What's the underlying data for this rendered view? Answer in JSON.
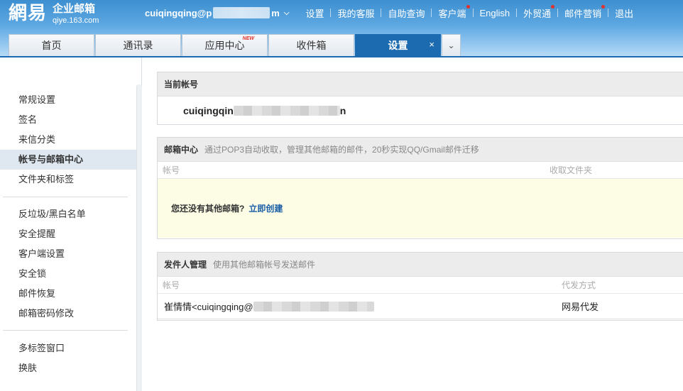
{
  "logo": {
    "main": "網易",
    "title": "企业邮箱",
    "domain": "qiye.163.com"
  },
  "account": {
    "visible_start": "cuiqingqing@p",
    "visible_end": "m"
  },
  "topnav": [
    {
      "label": "设置",
      "dot": false
    },
    {
      "label": "我的客服",
      "dot": false
    },
    {
      "label": "自助查询",
      "dot": false
    },
    {
      "label": "客户端",
      "dot": true
    },
    {
      "label": "English",
      "dot": false
    },
    {
      "label": "外贸通",
      "dot": true
    },
    {
      "label": "邮件营销",
      "dot": true
    },
    {
      "label": "退出",
      "dot": false
    }
  ],
  "tabs": [
    {
      "label": "首页"
    },
    {
      "label": "通讯录"
    },
    {
      "label": "应用中心",
      "badge": "NEW"
    },
    {
      "label": "收件箱"
    },
    {
      "label": "设置",
      "active": true,
      "close": "×"
    }
  ],
  "tab_more": "⌄",
  "sidebar": {
    "group1": [
      "常规设置",
      "签名",
      "来信分类",
      "帐号与邮箱中心",
      "文件夹和标签"
    ],
    "group2": [
      "反垃圾/黑白名单",
      "安全提醒",
      "客户端设置",
      "安全锁",
      "邮件恢复",
      "邮箱密码修改"
    ],
    "group3": [
      "多标签窗口",
      "换肤"
    ]
  },
  "current_account": {
    "title": "当前帐号",
    "account_visible": "cuiqingqin",
    "account_tail": "n"
  },
  "mailbox_center": {
    "title": "邮箱中心",
    "desc": "通过POP3自动收取，管理其他邮箱的邮件，20秒实现QQ/Gmail邮件迁移",
    "col_account": "帐号",
    "col_folder": "收取文件夹",
    "empty_text": "您还没有其他邮箱?",
    "create_link": "立即创建"
  },
  "sender_mgmt": {
    "title": "发件人管理",
    "desc": "使用其他邮箱帐号发送邮件",
    "col_account": "帐号",
    "col_method": "代发方式",
    "row_sender": "崔情情<cuiqingqing@",
    "row_method": "网易代发"
  }
}
